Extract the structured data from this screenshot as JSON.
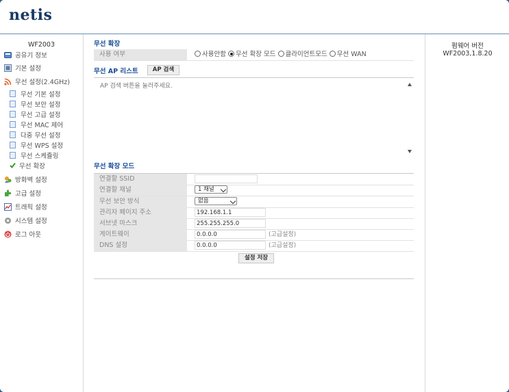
{
  "brand": {
    "logo": "netis"
  },
  "sidebar": {
    "model": "WF2003",
    "items": [
      {
        "label": "공유기 정보",
        "icon": "router-info-icon"
      },
      {
        "label": "기본 설정",
        "icon": "basic-settings-icon"
      },
      {
        "label": "무선 설정(2.4GHz)",
        "icon": "wifi-rss-icon",
        "children": [
          "무선 기본 설정",
          "무선 보안 설정",
          "무선 고급 설정",
          "무선 MAC 제어",
          "다중 무선 설정",
          "무선 WPS 설정",
          "무선 스케쥴링",
          "무선 확장"
        ]
      },
      {
        "label": "방화벽 설정",
        "icon": "firewall-icon"
      },
      {
        "label": "고급 설정",
        "icon": "puzzle-icon"
      },
      {
        "label": "트래픽 설정",
        "icon": "traffic-chart-icon"
      },
      {
        "label": "시스템 설정",
        "icon": "gear-icon"
      },
      {
        "label": "로그 아웃",
        "icon": "power-icon"
      }
    ]
  },
  "firmware": {
    "title": "펌웨어 버전",
    "version": "WF2003,1.8.20"
  },
  "main": {
    "extend_title": "무선 확장",
    "usage": {
      "label": "사용 여부",
      "options": [
        "사용안함",
        "무선 확장 모드",
        "클라이언트모드",
        "무선 WAN"
      ],
      "selected": "무선 확장 모드"
    },
    "ap_list": {
      "title": "무선 AP 리스트",
      "search_button": "AP 검색",
      "placeholder": "AP 검색 버튼을 눌러주세요."
    },
    "mode": {
      "title": "무선 확장 모드",
      "ssid_label": "연결할 SSID",
      "ssid_value": "",
      "channel_label": "연결할 채널",
      "channel_value": "1 채널",
      "security_label": "무선 보안 방식",
      "security_value": "없음",
      "admin_label": "관리자 페이지 주소",
      "admin_value": "192.168.1.1",
      "subnet_label": "서브넷 마스크",
      "subnet_value": "255.255.255.0",
      "gateway_label": "게이트웨이",
      "gateway_value": "0.0.0.0",
      "gateway_hint": "(고급설정)",
      "dns_label": "DNS 설정",
      "dns_value": "0.0.0.0",
      "dns_hint": "(고급설정)",
      "save_button": "설정 저장"
    }
  }
}
